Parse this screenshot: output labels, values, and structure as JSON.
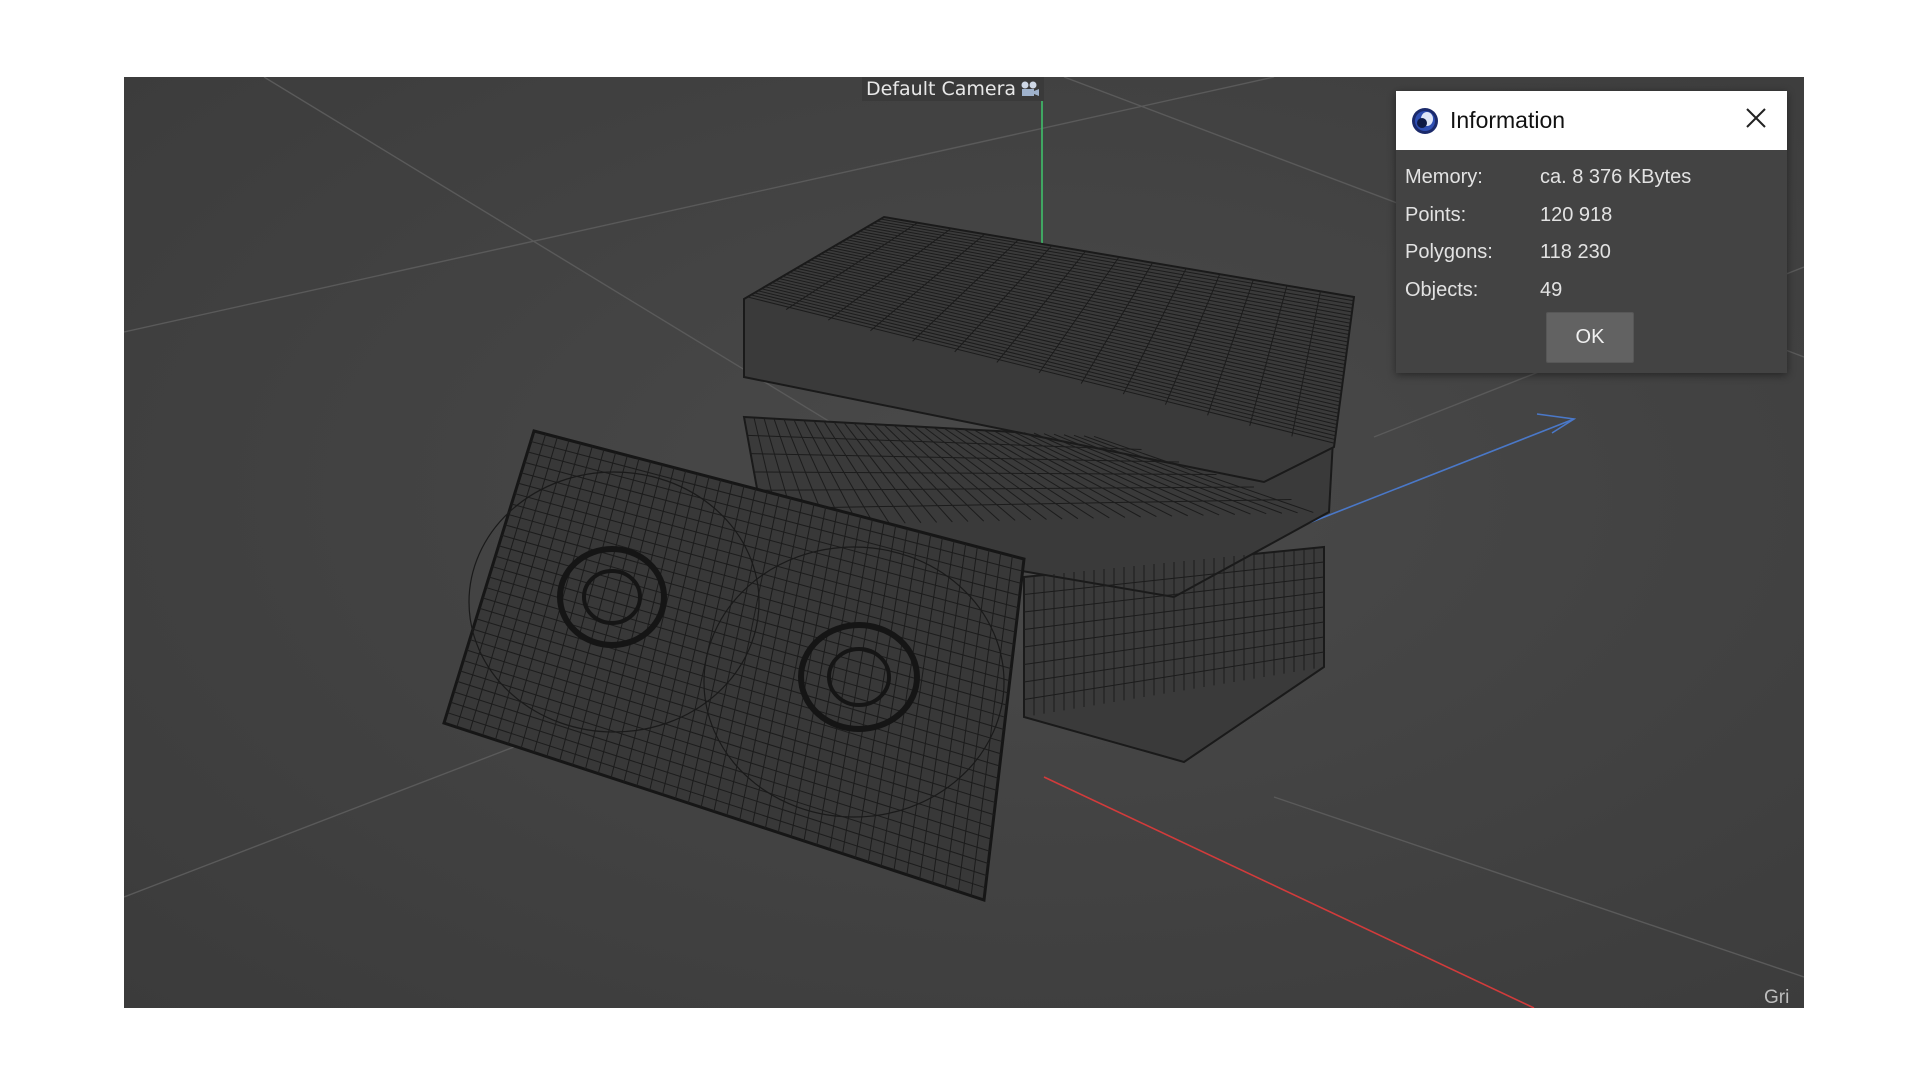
{
  "viewport": {
    "camera_label": "Default Camera",
    "grid_label": "Gri"
  },
  "dialog": {
    "title": "Information",
    "rows": [
      {
        "key": "Memory:",
        "value": "ca. 8 376 KBytes"
      },
      {
        "key": "Points:",
        "value": "120 918"
      },
      {
        "key": "Polygons:",
        "value": "118 230"
      },
      {
        "key": "Objects:",
        "value": "49"
      }
    ],
    "ok_label": "OK"
  },
  "colors": {
    "viewport_bg": "#434343",
    "axis_x": "#d23b3b",
    "axis_y": "#3fbf6a",
    "axis_z": "#4a78c8",
    "wireframe": "#111111",
    "dialog_bg": "#434343"
  },
  "icons": {
    "camera": "camera-icon",
    "app": "cinema4d-logo-icon",
    "close": "close-icon"
  }
}
